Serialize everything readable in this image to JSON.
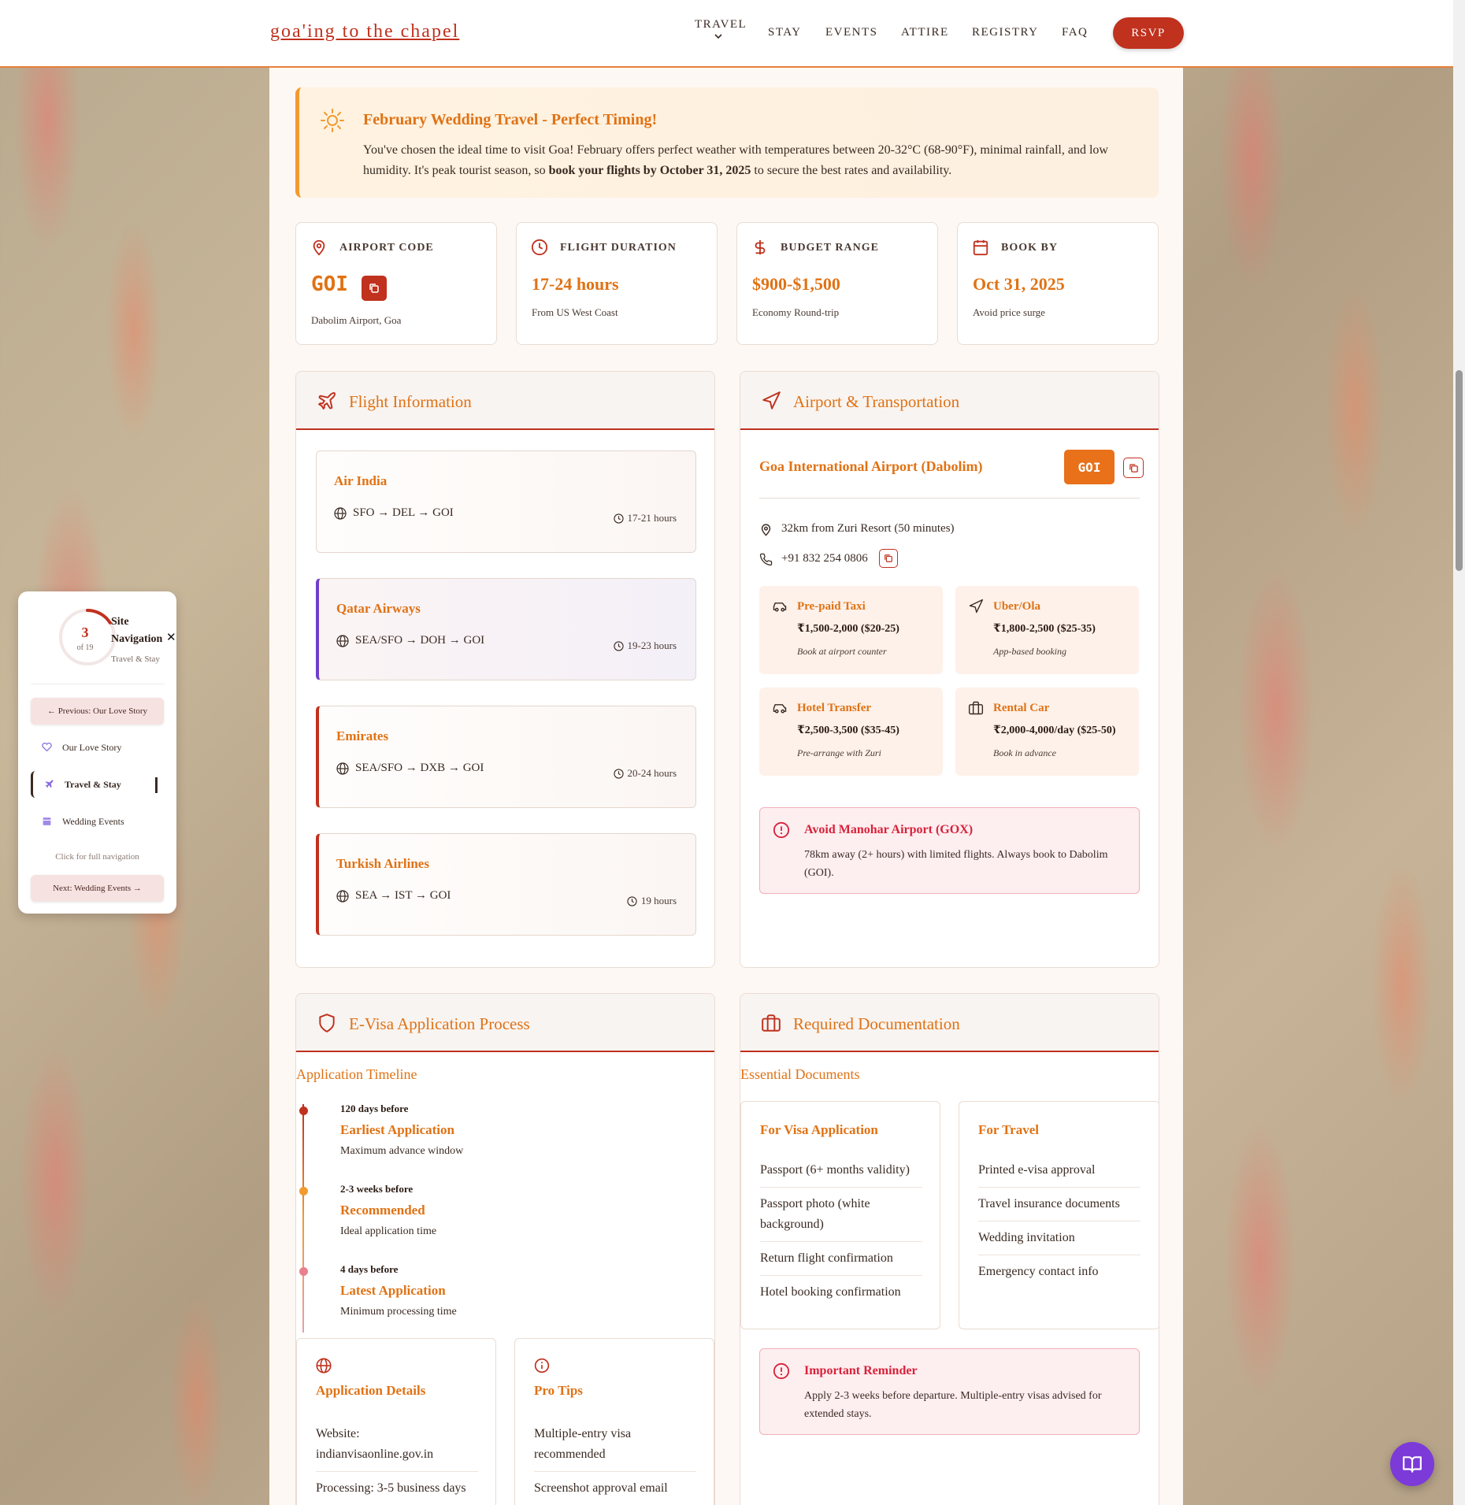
{
  "brand": "goa'ing to the chapel",
  "nav": {
    "items": [
      "TRAVEL",
      "STAY",
      "EVENTS",
      "ATTIRE",
      "REGISTRY",
      "FAQ"
    ],
    "rsvp": "RSVP"
  },
  "banner": {
    "title": "February Wedding Travel - Perfect Timing!",
    "text_before": "You've chosen the ideal time to visit Goa! February offers perfect weather with temperatures between 20-32°C (68-90°F), minimal rainfall, and low humidity. It's peak tourist season, so ",
    "text_bold": "book your flights by October 31, 2025",
    "text_after": " to secure the best rates and availability."
  },
  "stats": [
    {
      "label": "AIRPORT CODE",
      "value": "GOI",
      "sub": "Dabolim Airport, Goa",
      "icon": "map-pin-icon"
    },
    {
      "label": "FLIGHT DURATION",
      "value": "17-24 hours",
      "sub": "From US West Coast",
      "icon": "clock-icon"
    },
    {
      "label": "BUDGET RANGE",
      "value": "$900-$1,500",
      "sub": "Economy Round-trip",
      "icon": "dollar-icon"
    },
    {
      "label": "BOOK BY",
      "value": "Oct 31, 2025",
      "sub": "Avoid price surge",
      "icon": "calendar-icon"
    }
  ],
  "flight_panel": {
    "title": "Flight Information",
    "flights": [
      {
        "name": "Air India",
        "route": "SFO → DEL → GOI",
        "duration": "17-21 hours"
      },
      {
        "name": "Qatar Airways",
        "route": "SEA/SFO → DOH → GOI",
        "duration": "19-23 hours"
      },
      {
        "name": "Emirates",
        "route": "SEA/SFO → DXB → GOI",
        "duration": "20-24 hours"
      },
      {
        "name": "Turkish Airlines",
        "route": "SEA → IST → GOI",
        "duration": "19 hours"
      }
    ]
  },
  "airport_panel": {
    "title": "Airport & Transportation",
    "airport_name": "Goa International Airport (Dabolim)",
    "code": "GOI",
    "distance": "32km from Zuri Resort (50 minutes)",
    "phone": "+91 832 254 0806",
    "transport": [
      {
        "title": "Pre-paid Taxi",
        "price": "₹1,500-2,000 ($20-25)",
        "note": "Book at airport counter",
        "icon": "car-icon"
      },
      {
        "title": "Uber/Ola",
        "price": "₹1,800-2,500 ($25-35)",
        "note": "App-based booking",
        "icon": "navigation-icon"
      },
      {
        "title": "Hotel Transfer",
        "price": "₹2,500-3,500 ($35-45)",
        "note": "Pre-arrange with Zuri",
        "icon": "car-icon"
      },
      {
        "title": "Rental Car",
        "price": "₹2,000-4,000/day ($25-50)",
        "note": "Book in advance",
        "icon": "briefcase-icon"
      }
    ],
    "alert": {
      "title": "Avoid Manohar Airport (GOX)",
      "text": "78km away (2+ hours) with limited flights. Always book to Dabolim (GOI)."
    }
  },
  "visa_panel": {
    "title": "E-Visa Application Process",
    "timeline_heading": "Application Timeline",
    "timeline": [
      {
        "when": "120 days before",
        "what": "Earliest Application",
        "desc": "Maximum advance window"
      },
      {
        "when": "2-3 weeks before",
        "what": "Recommended",
        "desc": "Ideal application time"
      },
      {
        "when": "4 days before",
        "what": "Latest Application",
        "desc": "Minimum processing time"
      }
    ],
    "details": {
      "title": "Application Details",
      "items": [
        "Website: indianvisaonline.gov.in",
        "Processing: 3-5 business days"
      ]
    },
    "tips": {
      "title": "Pro Tips",
      "items": [
        "Multiple-entry visa recommended",
        "Screenshot approval email"
      ]
    }
  },
  "docs_panel": {
    "title": "Required Documentation",
    "heading": "Essential Documents",
    "visa_docs": {
      "title": "For Visa Application",
      "items": [
        "Passport (6+ months validity)",
        "Passport photo (white background)",
        "Return flight confirmation",
        "Hotel booking confirmation"
      ]
    },
    "travel_docs": {
      "title": "For Travel",
      "items": [
        "Printed e-visa approval",
        "Travel insurance documents",
        "Wedding invitation",
        "Emergency contact info"
      ]
    },
    "reminder": {
      "title": "Important Reminder",
      "text": "Apply 2-3 weeks before departure. Multiple-entry visas advised for extended stays."
    }
  },
  "side_nav": {
    "current": "3",
    "of": "of 19",
    "progress": 0.16,
    "title": "Site Navigation",
    "subtitle": "Travel & Stay",
    "prev": "← Previous: Our Love Story",
    "items": [
      "Our Love Story",
      "Travel & Stay",
      "Wedding Events"
    ],
    "hint": "Click for full navigation",
    "next": "Next: Wedding Events →"
  },
  "colors": {
    "primary": "#c0311e",
    "accent": "#e07214",
    "fab": "#7c3ad8"
  }
}
